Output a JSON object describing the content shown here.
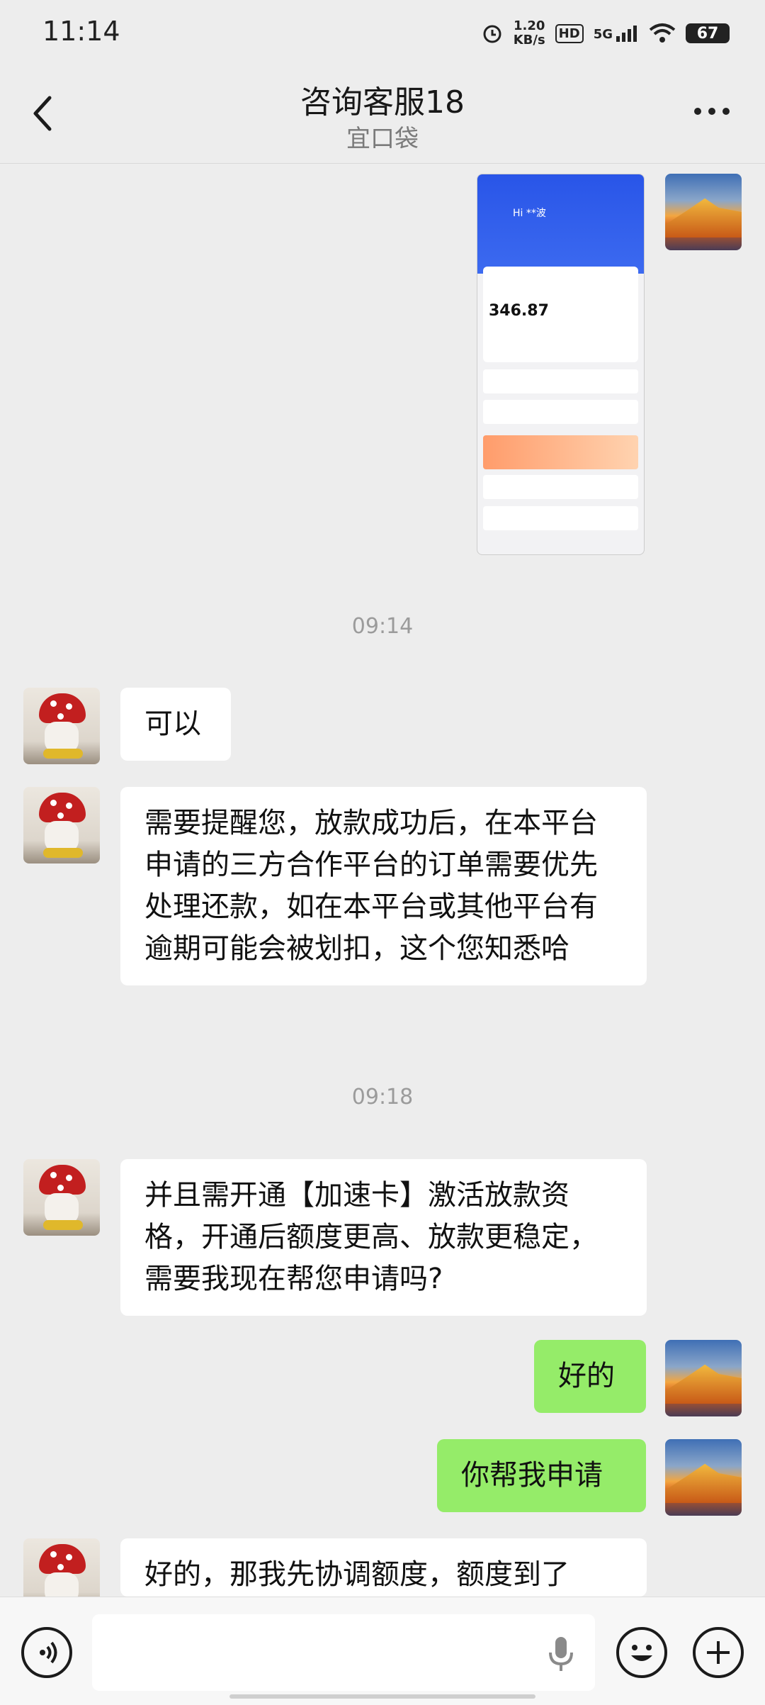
{
  "status_bar": {
    "time": "11:14",
    "net_speed": "1.20",
    "net_unit": "KB/s",
    "hd": "HD",
    "signal": "5G",
    "battery": "67"
  },
  "header": {
    "title": "咨询客服18",
    "subtitle": "宜口袋"
  },
  "screenshot_msg": {
    "greeting": "Hi **波",
    "amount": "346.87"
  },
  "timestamps": [
    "09:14",
    "09:18"
  ],
  "messages": [
    {
      "from": "agent",
      "text": "可以"
    },
    {
      "from": "agent",
      "text": "需要提醒您，放款成功后，在本平台申请的三方合作平台的订单需要优先处理还款，如在本平台或其他平台有逾期可能会被划扣，这个您知悉哈"
    },
    {
      "from": "agent",
      "text": "并且需开通【加速卡】激活放款资格，开通后额度更高、放款更稳定，需要我现在帮您申请吗?"
    },
    {
      "from": "me",
      "text": "好的"
    },
    {
      "from": "me",
      "text": "你帮我申请"
    },
    {
      "from": "agent",
      "text": "好的，那我先协调额度，额度到了"
    }
  ],
  "icons": {
    "back": "back-arrow-icon",
    "more": "more-icon",
    "voice": "voice-icon",
    "mic": "mic-icon",
    "emoji": "emoji-icon",
    "plus": "plus-icon"
  }
}
